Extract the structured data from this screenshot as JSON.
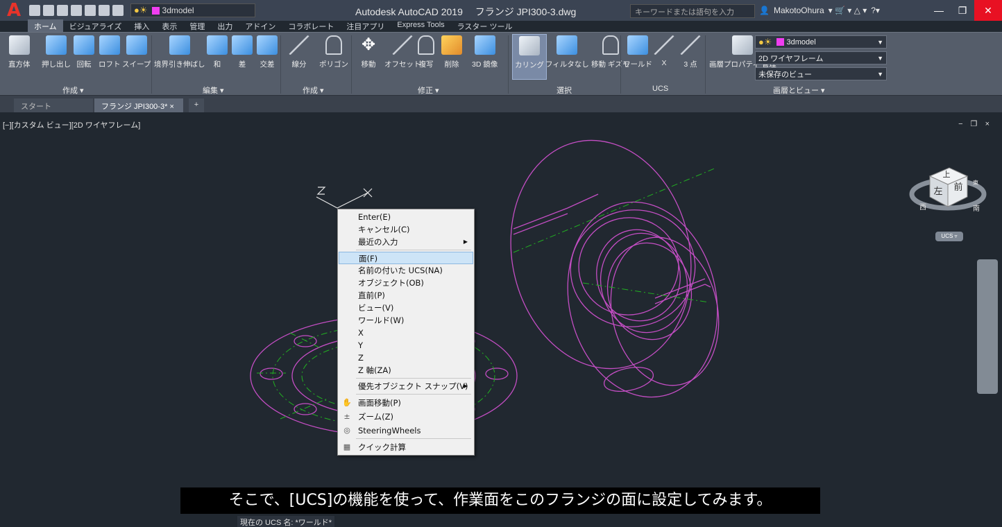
{
  "window": {
    "app_title": "Autodesk AutoCAD 2019　 フランジ JPI300-3.dwg",
    "search_placeholder": "キーワードまたは語句を入力",
    "user_name": "MakotoOhura",
    "layer_quick": "3dmodel"
  },
  "ribbon_tabs": [
    "ホーム",
    "ビジュアライズ",
    "挿入",
    "表示",
    "管理",
    "出力",
    "アドイン",
    "コラボレート",
    "注目アプリ",
    "Express Tools",
    "ラスター ツール"
  ],
  "tools": {
    "box": "直方体",
    "extrude": "押し出し",
    "revolve": "回転",
    "loft": "ロフト",
    "sweep": "スイープ",
    "presspull": "境界引き伸ばし",
    "union": "和",
    "subtract": "差",
    "intersect": "交差",
    "line": "線分",
    "polygon": "ポリゴン",
    "move": "移動",
    "offset": "オフセット",
    "copy": "複写",
    "erase": "削除",
    "mirror3d": "3D 鏡像",
    "culling": "カリング",
    "filter": "フィルタなし",
    "gizmo": "移動 ギズモ",
    "world": "ワールド",
    "ucs_x": "X",
    "ucs_3pt": "3 点",
    "layer_props": "画層プロパティ 管理"
  },
  "panels": {
    "modeling": "作成 ▾",
    "edit": "編集 ▾",
    "draw": "作成 ▾",
    "modify": "修正 ▾",
    "selection": "選択",
    "ucs": "UCS",
    "layers_view": "画層とビュー ▾"
  },
  "dropdowns": {
    "layer": "3dmodel",
    "visual_style": "2D ワイヤフレーム",
    "named_view": "未保存のビュー"
  },
  "file_tabs": {
    "start": "スタート",
    "current": "フランジ JPI300-3*",
    "plus": "+"
  },
  "viewport": {
    "label": "[−][カスタム ビュー][2D ワイヤフレーム]",
    "controls": "− ❐ ×",
    "ucs_badge": "UCS ▿",
    "cube_top": "上",
    "cube_left": "左",
    "cube_front": "前",
    "compass_w": "西",
    "compass_s": "南",
    "compass_e": "東"
  },
  "context_menu": {
    "enter": "Enter(E)",
    "cancel": "キャンセル(C)",
    "recent": "最近の入力",
    "face": "面(F)",
    "named": "名前の付いた UCS(NA)",
    "object": "オブジェクト(OB)",
    "previous": "直前(P)",
    "view": "ビュー(V)",
    "world": "ワールド(W)",
    "x": "X",
    "y": "Y",
    "z": "Z",
    "zaxis": "Z 軸(ZA)",
    "osnap": "優先オブジェクト スナップ(V)",
    "pan": "画面移動(P)",
    "zoom": "ズーム(Z)",
    "wheels": "SteeringWheels",
    "quickcalc": "クイック計算"
  },
  "caption": "そこで、[UCS]の機能を使って、作業面をこのフランジの面に設定してみます。",
  "status_line": "現在の UCS 名:  *ワールド*",
  "colors": {
    "accent_magenta": "#c44ec4",
    "center_green": "#22b022",
    "highlight": "#cde4f7"
  }
}
